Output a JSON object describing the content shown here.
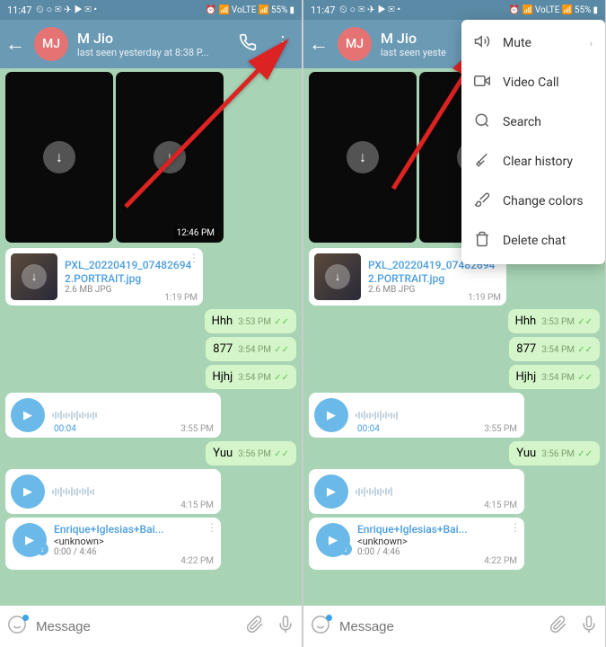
{
  "status": {
    "time": "11:47",
    "battery": "55%",
    "net": "VoLTE"
  },
  "header": {
    "avatar": "MJ",
    "name": "M Jio",
    "status_full": "last seen yesterday at 8:38 P...",
    "status_short": "last seen yeste"
  },
  "media": {
    "time": "12:46 PM"
  },
  "file": {
    "name": "PXL_20220419_074826942.PORTRAIT.jpg",
    "meta": "2.6 MB JPG",
    "time": "1:19 PM"
  },
  "msgs": [
    {
      "text": "Hhh",
      "time": "3:53 PM"
    },
    {
      "text": "877",
      "time": "3:54 PM"
    },
    {
      "text": "Hjhj",
      "time": "3:54 PM"
    }
  ],
  "voice": {
    "duration": "00:04",
    "time": "3:55 PM"
  },
  "msg_yuu": {
    "text": "Yuu",
    "time": "3:56 PM"
  },
  "voice2": {
    "time": "4:15 PM"
  },
  "music": {
    "title": "Enrique+Iglesias+Bai...",
    "artist": "<unknown>",
    "duration": "0:00 / 4:46",
    "time": "4:22 PM"
  },
  "input": {
    "placeholder": "Message"
  },
  "menu": [
    {
      "label": "Mute",
      "icon": "volume",
      "chev": true
    },
    {
      "label": "Video Call",
      "icon": "video"
    },
    {
      "label": "Search",
      "icon": "search"
    },
    {
      "label": "Clear history",
      "icon": "broom"
    },
    {
      "label": "Change colors",
      "icon": "brush"
    },
    {
      "label": "Delete chat",
      "icon": "trash"
    }
  ]
}
